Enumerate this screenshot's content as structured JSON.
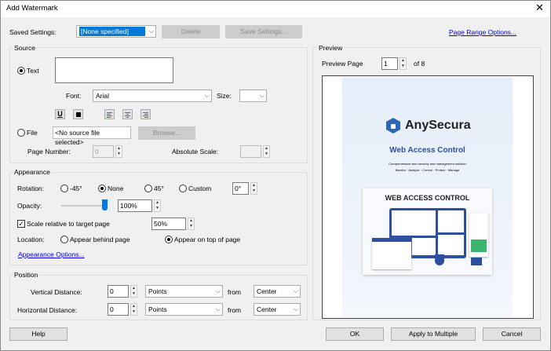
{
  "window": {
    "title": "Add Watermark",
    "close_icon": "close-icon"
  },
  "saved_settings": {
    "label": "Saved Settings:",
    "value": "[None specified]",
    "delete": "Delete",
    "save": "Save Settings..."
  },
  "page_range_link": "Page Range Options...",
  "source": {
    "title": "Source",
    "text_radio": "Text",
    "text_value": "",
    "font_label": "Font:",
    "font": "Arial",
    "size_label": "Size:",
    "size": "",
    "file_radio": "File",
    "file_value": "<No source file selected>",
    "browse": "Browse...",
    "page_number_label": "Page Number:",
    "page_number": "0",
    "absolute_scale_label": "Absolute Scale:",
    "absolute_scale": "",
    "underline": "U",
    "selected": "text"
  },
  "appearance": {
    "title": "Appearance",
    "rotation_label": "Rotation:",
    "rotation_options": [
      "-45°",
      "None",
      "45°",
      "Custom"
    ],
    "rotation_selected": "None",
    "custom_rotation": "0°",
    "opacity_label": "Opacity:",
    "opacity": "100%",
    "opacity_slider_percent": 100,
    "scale_checkbox": "Scale relative to target page",
    "scale_checked": true,
    "scale": "50%",
    "location_label": "Location:",
    "location_options": [
      "Appear behind page",
      "Appear on top of page"
    ],
    "location_selected": "Appear on top of page",
    "options_link": "Appearance Options..."
  },
  "position": {
    "title": "Position",
    "vertical_label": "Vertical Distance:",
    "vertical_value": "0",
    "vertical_units": "Points",
    "vertical_from_label": "from",
    "vertical_from": "Center",
    "horizontal_label": "Horizontal Distance:",
    "horizontal_value": "0",
    "horizontal_units": "Points",
    "horizontal_from_label": "from",
    "horizontal_from": "Center"
  },
  "preview": {
    "title": "Preview",
    "page_label": "Preview Page",
    "page": "1",
    "of": "of 8",
    "doc": {
      "brand": "AnySecura",
      "heading": "Web Access Control",
      "line1": "Comprehensive web security and management solution",
      "line2": "Monitor · Analyze · Control · Protect · Manage",
      "card_title": "WEB ACCESS CONTROL"
    }
  },
  "buttons": {
    "help": "Help",
    "ok": "OK",
    "apply_multiple": "Apply to Multiple",
    "cancel": "Cancel"
  },
  "colors": {
    "accent": "#0078d7",
    "brand": "#2d4fa0",
    "selection": "#0078d7"
  }
}
